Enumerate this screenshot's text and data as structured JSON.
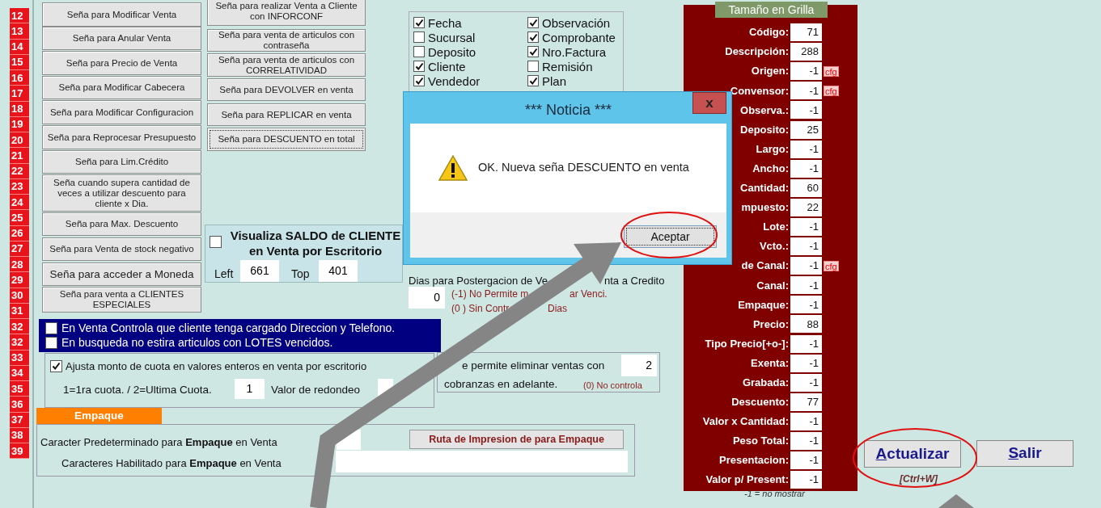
{
  "line_numbers": [
    "12",
    "13",
    "14",
    "15",
    "16",
    "17",
    "18",
    "19",
    "20",
    "21",
    "22",
    "23",
    "24",
    "25",
    "26",
    "27",
    "28",
    "29",
    "30",
    "31",
    "32",
    "32",
    "33",
    "34",
    "35",
    "36",
    "37",
    "38",
    "39"
  ],
  "left_buttons": [
    "Seña para Modificar Venta",
    "Seña para Anular Venta",
    "Seña para Precio de Venta",
    "Seña para Modificar Cabecera",
    "Seña para Modificar Configuracion",
    "Seña para Reprocesar Presupuesto",
    "Seña para Lim.Crédito",
    "Seña cuando supera cantidad de veces a utilizar descuento para cliente x Dia.",
    "Seña para Max. Descuento",
    "Seña para Venta de stock negativo",
    "Seña para acceder a Moneda",
    "Seña para venta a CLIENTES ESPECIALES"
  ],
  "right_buttons": [
    {
      "label": "Seña para realizar Venta a Cliente con INFORCONF",
      "focused": false
    },
    {
      "label": "Seña para venta de articulos con contraseña",
      "focused": false
    },
    {
      "label": "Seña para venta de articulos con CORRELATIVIDAD",
      "focused": false
    },
    {
      "label": "Seña para DEVOLVER en venta",
      "focused": false
    },
    {
      "label": "Seña para REPLICAR en venta",
      "focused": false
    },
    {
      "label": "Seña para DESCUENTO en total",
      "focused": true
    }
  ],
  "saldo_panel": {
    "checked": false,
    "title_lines": [
      "Visualiza SALDO de CLIENTE",
      "en Venta por Escritorio"
    ],
    "left_label": "Left",
    "left_value": "661",
    "top_label": "Top",
    "top_value": "401"
  },
  "column_options": [
    [
      {
        "label": "Fecha",
        "checked": true
      },
      {
        "label": "Sucursal",
        "checked": false
      },
      {
        "label": "Deposito",
        "checked": false
      },
      {
        "label": "Cliente",
        "checked": true
      },
      {
        "label": "Vendedor",
        "checked": true
      }
    ],
    [
      {
        "label": "Observación",
        "checked": true
      },
      {
        "label": "Comprobante",
        "checked": true
      },
      {
        "label": "Nro.Factura",
        "checked": true
      },
      {
        "label": "Remisión",
        "checked": false
      },
      {
        "label": "Plan",
        "checked": true
      }
    ]
  ],
  "dialog": {
    "title": "*** Noticia ***",
    "close": "x",
    "message": "OK. Nueva seña DESCUENTO en venta",
    "button": "Aceptar"
  },
  "postergacion": {
    "label_parts": [
      "Dias para Postergacion de Ve",
      "nta a Credito"
    ],
    "value": "0",
    "notes": [
      [
        "(-1) No Permite m",
        "ar Venci."
      ],
      [
        "(0 ) Sin Contr",
        "Dias"
      ]
    ]
  },
  "blue_options": [
    {
      "label": "En Venta Controla que cliente tenga cargado Direccion y Telefono.",
      "checked": false
    },
    {
      "label": "En busqueda no estira articulos con LOTES vencidos.",
      "checked": false
    }
  ],
  "ajusta": {
    "checked": true,
    "label": "Ajusta monto de cuota en valores enteros en venta por escritorio",
    "cuota_label": "1=1ra cuota. / 2=Ultima Cuota.",
    "cuota_value": "1",
    "redondeo_label": "Valor de redondeo"
  },
  "eliminar": {
    "label": "e permite eliminar ventas con",
    "value": "2",
    "label2": "cobranzas en adelante.",
    "note": "(0) No controla"
  },
  "empaque": {
    "tab": "Empaque",
    "row1": "Caracter Predeterminado para **Empaque** en Venta",
    "row2": "Caracteres Habilitado para **Empaque** en Venta",
    "button": "Ruta de Impresion de para Empaque"
  },
  "grid": {
    "title": "Tamaño en Grilla",
    "note": "-1 = no mostrar",
    "rows": [
      {
        "label": "Código:",
        "value": "71"
      },
      {
        "label": "Descripción:",
        "value": "288"
      },
      {
        "label": "Origen:",
        "value": "-1",
        "cfg": "cfg"
      },
      {
        "label": "Convensor:",
        "value": "-1",
        "cfg": "cfg"
      },
      {
        "label": "Observa.:",
        "value": "-1"
      },
      {
        "label": "Deposito:",
        "value": "25"
      },
      {
        "label": "Largo:",
        "value": "-1"
      },
      {
        "label": "Ancho:",
        "value": "-1"
      },
      {
        "label": "Cantidad:",
        "value": "60"
      },
      {
        "label": "mpuesto:",
        "value": "22"
      },
      {
        "label": "Lote:",
        "value": "-1"
      },
      {
        "label": "Vcto.:",
        "value": "-1"
      },
      {
        "label": "de Canal:",
        "value": "-1",
        "cfg": "cfg"
      },
      {
        "label": "Canal:",
        "value": "-1"
      },
      {
        "label": "Empaque:",
        "value": "-1"
      },
      {
        "label": "Precio:",
        "value": "88"
      },
      {
        "label": "Tipo Precio[+o-]:",
        "value": "-1"
      },
      {
        "label": "Exenta:",
        "value": "-1"
      },
      {
        "label": "Grabada:",
        "value": "-1"
      },
      {
        "label": "Descuento:",
        "value": "77"
      },
      {
        "label": "Valor x Cantidad:",
        "value": "-1"
      },
      {
        "label": "Peso Total:",
        "value": "-1"
      },
      {
        "label": "Presentacion:",
        "value": "-1"
      },
      {
        "label": "Valor p/ Present:",
        "value": "-1"
      }
    ]
  },
  "actions": {
    "update": {
      "label": "Actualizar",
      "shortcut": "[Ctrl+W]"
    },
    "exit": {
      "label": "Salir"
    }
  }
}
